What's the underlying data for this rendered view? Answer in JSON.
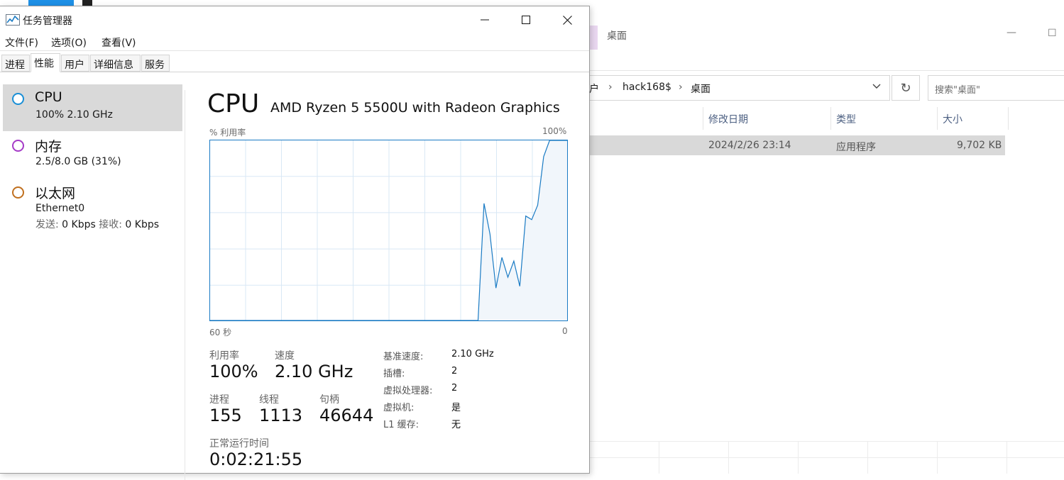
{
  "explorer": {
    "title": "桌面",
    "breadcrumb": [
      "户",
      "hack168$",
      "桌面"
    ],
    "search_placeholder": "搜索\"桌面\"",
    "refresh_icon": "refresh-icon",
    "columns": [
      "修改日期",
      "类型",
      "大小"
    ],
    "row": {
      "date": "2024/2/26 23:14",
      "type": "应用程序",
      "size": "9,702 KB"
    }
  },
  "task_manager": {
    "title": "任务管理器",
    "window_controls": {
      "minimize": "—",
      "maximize": "☐",
      "close": "✕"
    },
    "menu": [
      "文件(F)",
      "选项(O)",
      "查看(V)"
    ],
    "tabs": [
      "进程",
      "性能",
      "用户",
      "详细信息",
      "服务"
    ],
    "active_tab": "性能",
    "sidebar": {
      "cpu": {
        "name": "CPU",
        "sub": "100%  2.10 GHz",
        "color": "#1a8fd6"
      },
      "memory": {
        "name": "内存",
        "sub": "2.5/8.0 GB (31%)",
        "color": "#a53bc7"
      },
      "ethernet": {
        "name": "以太网",
        "sub1": "Ethernet0",
        "send_label": "发送:",
        "send_value": "0 Kbps",
        "recv_label": "接收:",
        "recv_value": "0 Kbps",
        "color": "#c0701f"
      }
    },
    "cpu_panel": {
      "title": "CPU",
      "model": "AMD Ryzen 5 5500U with Radeon Graphics",
      "graph_ylabel": "% 利用率",
      "graph_ymax_label": "100%",
      "graph_x_left": "60 秒",
      "graph_x_right": "0",
      "stats": {
        "utilization_label": "利用率",
        "utilization": "100%",
        "speed_label": "速度",
        "speed": "2.10 GHz",
        "processes_label": "进程",
        "processes": "155",
        "threads_label": "线程",
        "threads": "1113",
        "handles_label": "句柄",
        "handles": "46644",
        "uptime_label": "正常运行时间",
        "uptime": "0:02:21:55"
      },
      "details": [
        {
          "key": "基准速度:",
          "value": "2.10 GHz"
        },
        {
          "key": "插槽:",
          "value": "2"
        },
        {
          "key": "虚拟处理器:",
          "value": "2"
        },
        {
          "key": "虚拟机:",
          "value": "是"
        },
        {
          "key": "L1 缓存:",
          "value": "无"
        }
      ]
    }
  },
  "chart_data": {
    "type": "area",
    "x": [
      0,
      1,
      2,
      3,
      4,
      5,
      6,
      7,
      8,
      9,
      10,
      11,
      12,
      13,
      14,
      15,
      16,
      17,
      18,
      19,
      20,
      21,
      22,
      23,
      24,
      25,
      26,
      27,
      28,
      29,
      30,
      31,
      32,
      33,
      34,
      35,
      36,
      37,
      38,
      39,
      40,
      41,
      42,
      43,
      44,
      45,
      46,
      47,
      48,
      49,
      50,
      51,
      52,
      53,
      54,
      55,
      56,
      57,
      58,
      59,
      60
    ],
    "values": [
      0,
      0,
      0,
      0,
      0,
      0,
      0,
      0,
      0,
      0,
      0,
      0,
      0,
      0,
      0,
      0,
      0,
      0,
      0,
      0,
      0,
      0,
      0,
      0,
      0,
      0,
      0,
      0,
      0,
      0,
      0,
      0,
      0,
      0,
      0,
      0,
      0,
      0,
      0,
      0,
      0,
      0,
      0,
      0,
      0,
      0,
      65,
      48,
      18,
      35,
      24,
      33,
      19,
      58,
      56,
      64,
      91,
      100,
      100,
      100,
      100
    ],
    "ylabel": "% 利用率",
    "ylim": [
      0,
      100
    ],
    "color": "#1a7bc4",
    "fill": "#f1f6fb",
    "grid": true
  }
}
